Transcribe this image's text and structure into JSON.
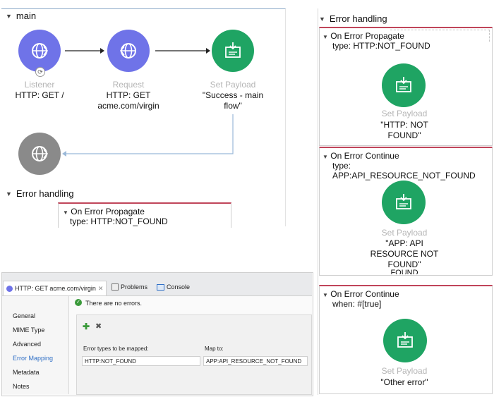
{
  "main_flow": {
    "title": "main",
    "listener": {
      "type": "Listener",
      "value": "HTTP: GET /"
    },
    "request": {
      "type": "Request",
      "value_line1": "HTTP: GET",
      "value_line2": "acme.com/virgin"
    },
    "set_payload": {
      "type": "Set Payload",
      "value_line1": "\"Success - main",
      "value_line2": "flow\""
    },
    "error_handling": {
      "title": "Error handling",
      "handler_title": "On Error Propagate",
      "handler_type": "type: HTTP:NOT_FOUND"
    }
  },
  "right_error_handling": {
    "title": "Error handling",
    "handlers": [
      {
        "title": "On Error Propagate",
        "condition": "type: HTTP:NOT_FOUND",
        "component": "Set Payload",
        "value_lines": [
          "\"HTTP: NOT",
          "FOUND\""
        ]
      },
      {
        "title": "On Error Continue",
        "condition": "type: APP:API_RESOURCE_NOT_FOUND",
        "component": "Set Payload",
        "value_lines": [
          "\"APP: API",
          "RESOURCE NOT",
          "FOUND\""
        ],
        "clipped_line": "FOUND"
      },
      {
        "title": "On Error Continue",
        "condition": "when: #[true]",
        "component": "Set Payload",
        "value_lines": [
          "\"Other error\""
        ]
      }
    ]
  },
  "properties": {
    "tabs": [
      "HTTP: GET acme.com/virgin",
      "Problems",
      "Console"
    ],
    "status": "There are no errors.",
    "sidebar": [
      "General",
      "MIME Type",
      "Advanced",
      "Error Mapping",
      "Metadata",
      "Notes"
    ],
    "active_sidebar": "Error Mapping",
    "mapping": {
      "col1_header": "Error types to be mapped:",
      "col2_header": "Map to:",
      "col1_value": "HTTP:NOT_FOUND",
      "col2_value": "APP:API_RESOURCE_NOT_FOUND"
    }
  },
  "colors": {
    "flow_blue": "#6f73e8",
    "payload_green": "#1fa463",
    "error_red": "#c0455a",
    "accent_blue": "#2f6fc6"
  }
}
